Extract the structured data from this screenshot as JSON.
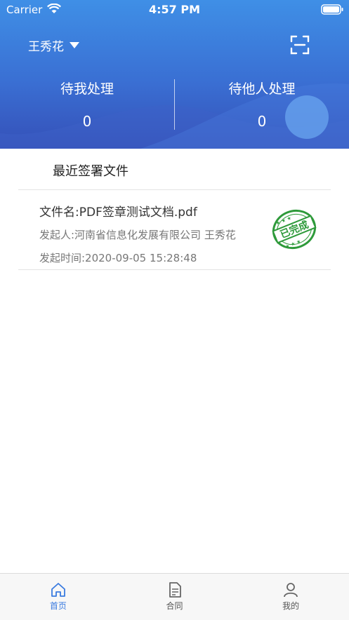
{
  "status_bar": {
    "carrier": "Carrier",
    "time": "4:57 PM"
  },
  "header": {
    "user_name": "王秀花",
    "stats": [
      {
        "label": "待我处理",
        "count": "0"
      },
      {
        "label": "待他人处理",
        "count": "0"
      }
    ]
  },
  "recent": {
    "title": "最近签署文件",
    "documents": [
      {
        "name": "文件名:PDF签章测试文档.pdf",
        "initiator": "发起人:河南省信息化发展有限公司 王秀花",
        "created": "发起时间:2020-09-05 15:28:48",
        "status_stamp": "已完成"
      }
    ]
  },
  "tabbar": {
    "tabs": [
      {
        "label": "首页",
        "icon": "home-icon",
        "active": true
      },
      {
        "label": "合同",
        "icon": "document-icon",
        "active": false
      },
      {
        "label": "我的",
        "icon": "person-icon",
        "active": false
      }
    ]
  },
  "colors": {
    "accent": "#3a7be0",
    "header_top": "#3f8fe6",
    "header_bottom": "#3550b8",
    "stamp": "#2e9a3a"
  }
}
